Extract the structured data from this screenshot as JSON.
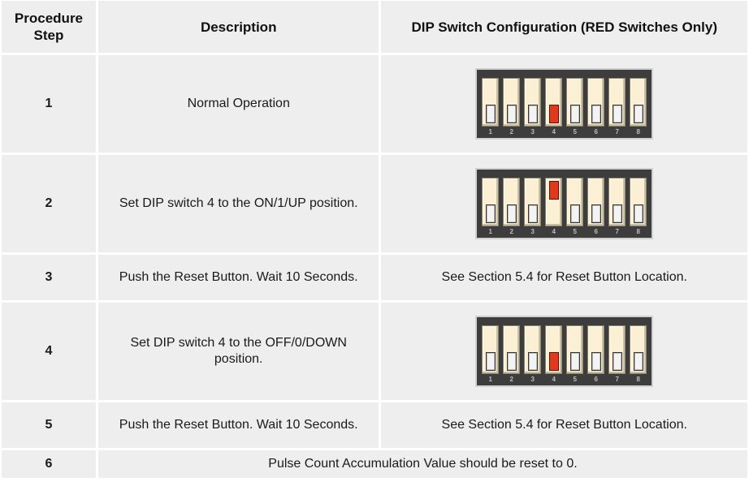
{
  "table": {
    "headers": {
      "step": "Procedure Step",
      "description": "Description",
      "config": "DIP Switch Configuration (RED Switches Only)"
    },
    "rows": [
      {
        "step": "1",
        "description": "Normal Operation",
        "config_type": "dip",
        "dip": {
          "switches": [
            "down",
            "down",
            "down",
            "down",
            "down",
            "down",
            "down",
            "down"
          ],
          "red": [
            4
          ]
        }
      },
      {
        "step": "2",
        "description": "Set DIP switch 4 to the ON/1/UP position.",
        "config_type": "dip",
        "dip": {
          "switches": [
            "down",
            "down",
            "down",
            "up",
            "down",
            "down",
            "down",
            "down"
          ],
          "red": [
            4
          ]
        }
      },
      {
        "step": "3",
        "description": "Push the Reset Button.  Wait 10 Seconds.",
        "config_type": "text",
        "config": "See Section 5.4 for Reset Button Location."
      },
      {
        "step": "4",
        "description": "Set DIP switch 4 to the OFF/0/DOWN position.",
        "config_type": "dip",
        "dip": {
          "switches": [
            "down",
            "down",
            "down",
            "down",
            "down",
            "down",
            "down",
            "down"
          ],
          "red": [
            4
          ]
        }
      },
      {
        "step": "5",
        "description": "Push the Reset Button.  Wait 10 Seconds.",
        "config_type": "text",
        "config": "See Section 5.4 for Reset Button Location."
      },
      {
        "step": "6",
        "merged_text": "Pulse Count Accumulation Value should be reset to 0."
      }
    ],
    "switch_labels": [
      "1",
      "2",
      "3",
      "4",
      "5",
      "6",
      "7",
      "8"
    ]
  },
  "colors": {
    "cell_bg": "#eeeeee",
    "grid": "#ffffff",
    "red_switch": "#e0391b",
    "dip_body": "#3d3d3d",
    "switch_well": "#fcf0d4"
  }
}
